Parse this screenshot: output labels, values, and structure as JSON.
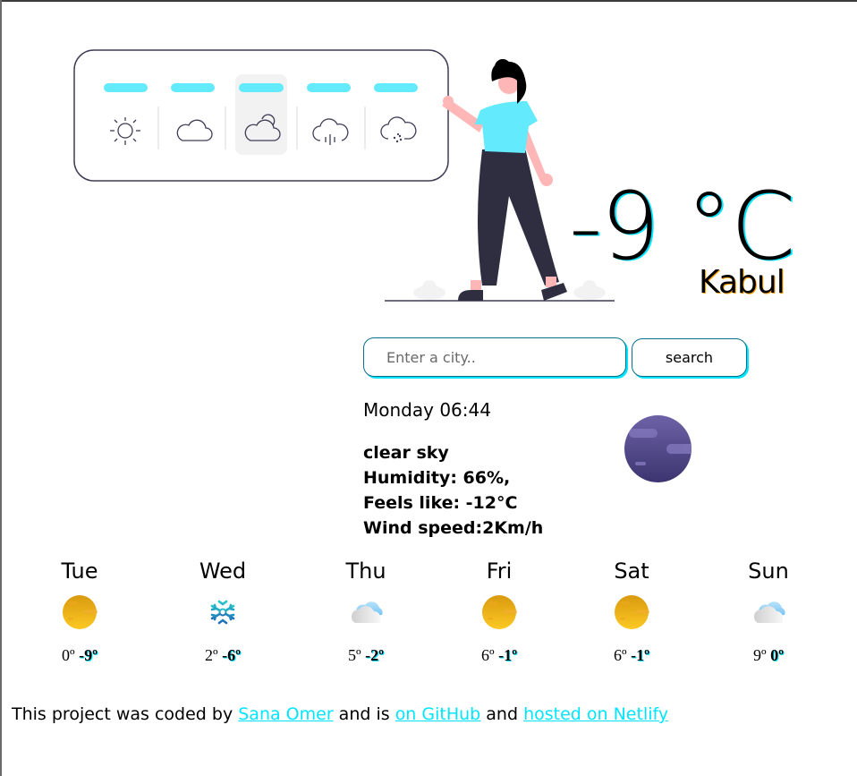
{
  "illustration": {
    "cards": [
      "sunny",
      "cloudy",
      "partly-cloudy",
      "rain",
      "snow"
    ],
    "selected_card": "partly-cloudy",
    "accent_color": "#63eafc"
  },
  "current": {
    "temperature": "-9 °C",
    "city": "Kabul",
    "datetime": "Monday 06:44",
    "description": "clear sky",
    "humidity": "Humidity: 66%,",
    "feels_like": "Feels like: -12°C",
    "wind": "Wind speed:2Km/h",
    "icon": "moon-night-icon"
  },
  "search": {
    "placeholder": "Enter a city..",
    "value": "",
    "button_label": "search"
  },
  "forecast": [
    {
      "day": "Tue",
      "icon": "sun-icon",
      "max": "0º",
      "min": "-9º"
    },
    {
      "day": "Wed",
      "icon": "snowflake-icon",
      "max": "2º",
      "min": "-6º"
    },
    {
      "day": "Thu",
      "icon": "cloud-icon",
      "max": "5º",
      "min": "-2º"
    },
    {
      "day": "Fri",
      "icon": "sun-icon",
      "max": "6º",
      "min": "-1º"
    },
    {
      "day": "Sat",
      "icon": "sun-icon",
      "max": "6º",
      "min": "-1º"
    },
    {
      "day": "Sun",
      "icon": "cloud-icon",
      "max": "9º",
      "min": "0º"
    }
  ],
  "footer": {
    "text1": "This project was coded by ",
    "author_link": "Sana Omer",
    "text2": " and is ",
    "github_link": "on GitHub",
    "text3": " and ",
    "netlify_link": "hosted on Netlify",
    "link_color": "#00e5ff"
  }
}
